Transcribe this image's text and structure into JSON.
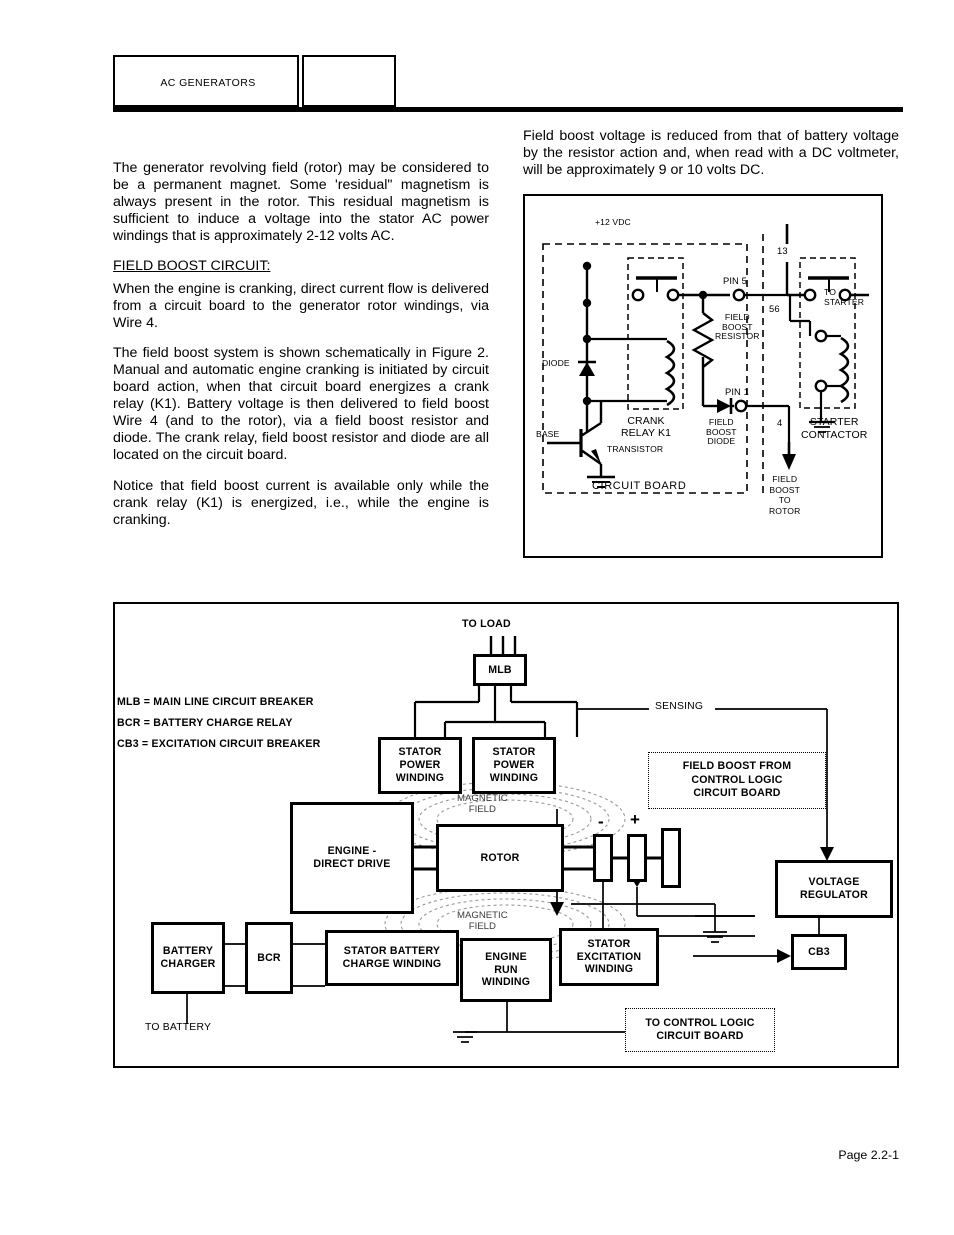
{
  "header": {
    "title": "AC GENERATORS",
    "blank_box": ""
  },
  "left_column": {
    "paragraphs": [
      "The generator revolving field (rotor) may be considered to be a permanent magnet. Some 'residual\" magnetism is always present in the rotor. This residual magnetism is sufficient to induce a voltage into the stator AC power windings that is approximately 2-12 volts AC.",
      "When the engine is cranking, direct current flow is delivered from a circuit board to the generator rotor windings, via Wire 4.",
      "The field boost system is shown schematically in Figure 2. Manual and automatic engine cranking is initiated by circuit board action, when that circuit board energizes a crank relay (K1). Battery voltage is then delivered to field boost Wire 4 (and to the rotor), via a field boost resistor and diode. The crank relay, field boost resistor and diode are all located on the circuit board.",
      "Notice that field boost current is available only while the crank relay (K1) is energized, i.e., while the engine is cranking."
    ],
    "section_heading": "FIELD BOOST CIRCUIT:"
  },
  "right_column": {
    "paragraphs": [
      "Field boost voltage is reduced from that of battery voltage by the resistor action and, when read with a DC voltmeter, will be approximately 9 or 10 volts DC."
    ]
  },
  "schematic": {
    "labels": {
      "supply": "+12 VDC",
      "diode": "DIODE",
      "base": "BASE",
      "transistor": "TRANSISTOR",
      "crank_relay": "CRANK\nRELAY K1",
      "field_boost_resistor": "FIELD\nBOOST\nRESISTOR",
      "field_boost_diode": "FIELD\nBOOST\nDIODE",
      "pin5": "PIN 5",
      "pin1": "PIN 1",
      "wire13": "13",
      "wire56": "56",
      "wire4": "4",
      "to_starter": "TO\nSTARTER",
      "starter_contactor": "STARTER\nCONTACTOR",
      "circuit_board": "CIRCUIT BOARD",
      "field_boost_to_rotor": "FIELD\nBOOST\nTO\nROTOR"
    }
  },
  "block_diagram": {
    "legend": [
      "MLB = MAIN LINE CIRCUIT BREAKER",
      "BCR = BATTERY CHARGE RELAY",
      "CB3 = EXCITATION CIRCUIT BREAKER"
    ],
    "to_load": "TO LOAD",
    "mlb": "MLB",
    "sensing": "SENSING",
    "stator_power_winding_1": "STATOR\nPOWER\nWINDING",
    "stator_power_winding_2": "STATOR\nPOWER\nWINDING",
    "magnetic_field_top": "MAGNETIC\nFIELD",
    "magnetic_field_bottom": "MAGNETIC\nFIELD",
    "engine_direct_drive": "ENGINE -\nDIRECT DRIVE",
    "rotor": "ROTOR",
    "brush_minus": "-",
    "brush_plus": "+",
    "field_boost_box": "FIELD BOOST FROM\nCONTROL LOGIC\nCIRCUIT BOARD",
    "voltage_regulator": "VOLTAGE\nREGULATOR",
    "battery_charger": "BATTERY\nCHARGER",
    "bcr": "BCR",
    "stator_battery_charge_winding": "STATOR BATTERY\nCHARGE WINDING",
    "engine_run_winding": "ENGINE\nRUN\nWINDING",
    "stator_excitation_winding": "STATOR\nEXCITATION\nWINDING",
    "cb3": "CB3",
    "to_battery": "TO BATTERY",
    "to_control_logic": "TO CONTROL LOGIC\nCIRCUIT BOARD"
  },
  "footer": {
    "page_number": "Page 2.2-1"
  }
}
